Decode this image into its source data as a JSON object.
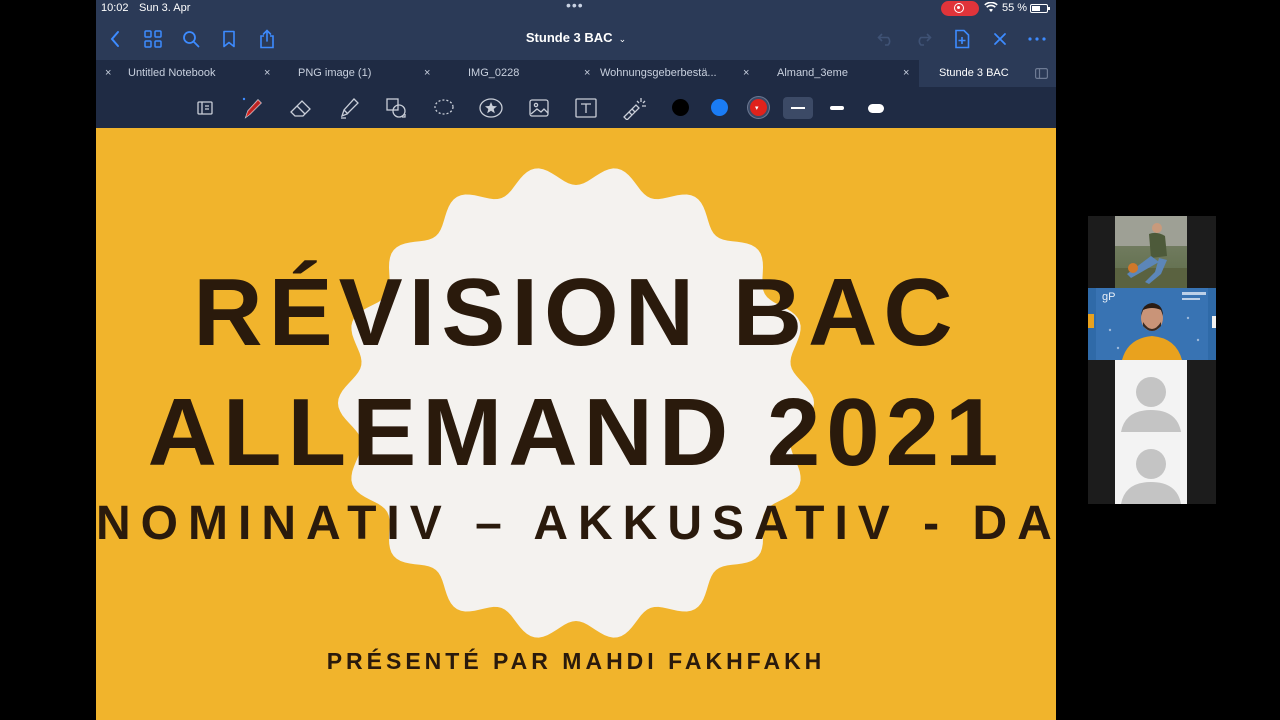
{
  "status_bar": {
    "time": "10:02",
    "date": "Sun 3. Apr",
    "battery": "55 %"
  },
  "nav": {
    "title": "Stunde 3 BAC"
  },
  "tabs": [
    {
      "label": "Untitled Notebook",
      "active": false
    },
    {
      "label": "PNG image (1)",
      "active": false
    },
    {
      "label": "IMG_0228",
      "active": false
    },
    {
      "label": "Wohnungsgeberbestä...",
      "active": false
    },
    {
      "label": "Almand_3eme",
      "active": false
    },
    {
      "label": "Stunde 3 BAC",
      "active": true
    }
  ],
  "toolbar": {
    "tools": [
      "page-select-icon",
      "pen-icon",
      "eraser-icon",
      "highlighter-icon",
      "shapes-icon",
      "lasso-icon",
      "star-sticker-icon",
      "image-icon",
      "text-tool-icon",
      "laser-pointer-icon"
    ],
    "colors": [
      "#000000",
      "#1a7cf5",
      "#e0221c"
    ],
    "selected_color": "#e0221c"
  },
  "slide": {
    "title_line1": "RÉVISION BAC",
    "title_line2": "ALLEMAND 2021",
    "subtitle": "NOMINATIV – AKKUSATIV - DATIV",
    "presenter": "PRÉSENTÉ PAR MAHDI FAKHFAKH",
    "background_color": "#f1b42c",
    "badge_color": "#f4f2ef",
    "text_color": "#2a1a0c"
  },
  "video_sidebar": {
    "participants": [
      {
        "type": "video",
        "description": "man-sitting-outdoors"
      },
      {
        "type": "video",
        "description": "presenter-yellow-hoodie"
      },
      {
        "type": "avatar-placeholder"
      },
      {
        "type": "avatar-placeholder"
      }
    ]
  }
}
